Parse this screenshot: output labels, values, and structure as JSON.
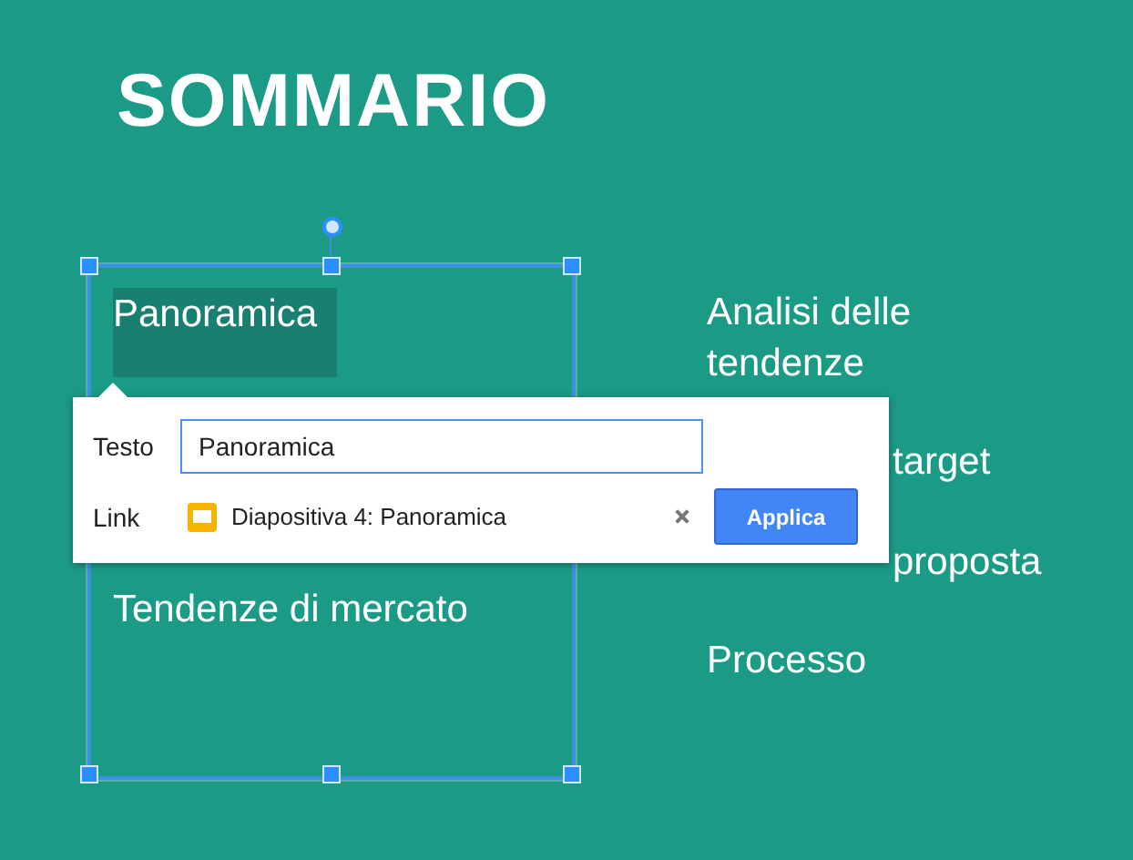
{
  "slide": {
    "title": "SOMMARIO",
    "left_items": [
      {
        "text": "Panoramica",
        "selected": true
      },
      {
        "text": "Tendenze di mercato",
        "selected": false
      }
    ],
    "right_items": [
      "Analisi delle tendenze",
      "target",
      "proposta",
      "Processo"
    ]
  },
  "link_popup": {
    "text_label": "Testo",
    "text_value": "Panoramica",
    "link_label": "Link",
    "link_target": "Diapositiva 4: Panoramica",
    "apply_button": "Applica"
  }
}
